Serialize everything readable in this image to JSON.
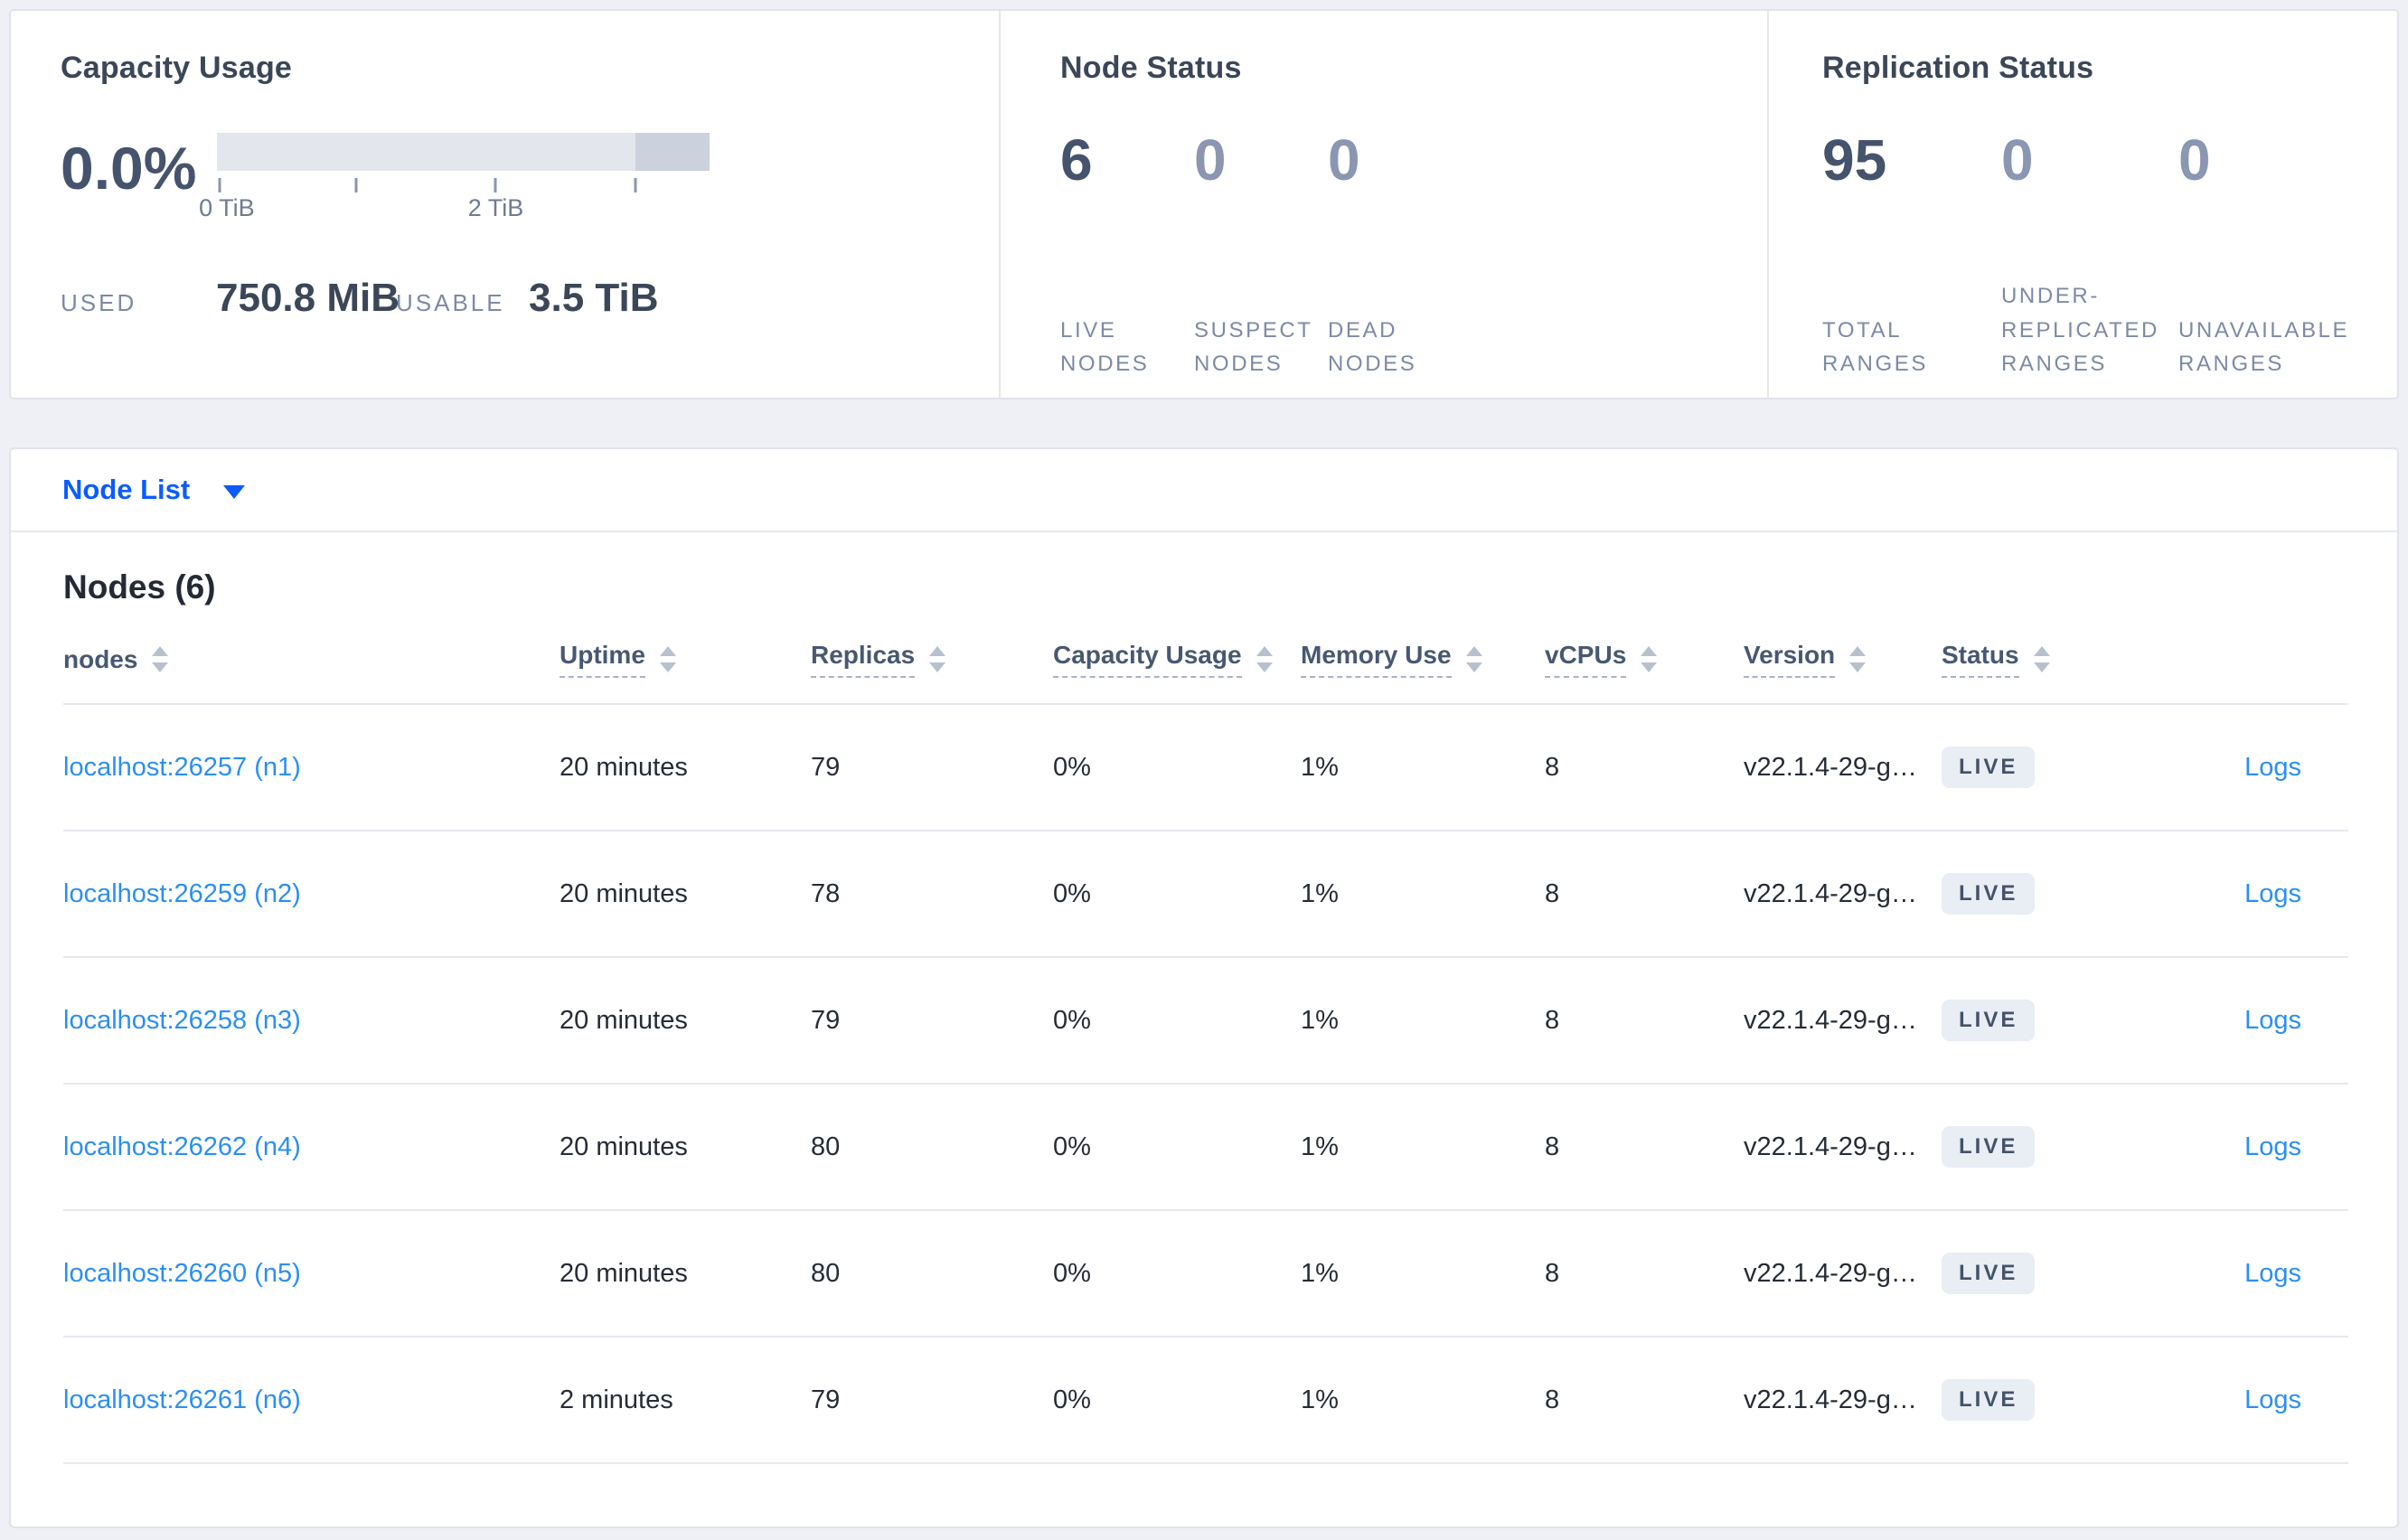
{
  "summary": {
    "capacity": {
      "title": "Capacity Usage",
      "percent": "0.0%",
      "tick_label_0": "0 TiB",
      "tick_label_2": "2 TiB",
      "used_label": "USED",
      "used_value": "750.8 MiB",
      "usable_label": "USABLE",
      "usable_value": "3.5 TiB"
    },
    "node_status": {
      "title": "Node Status",
      "stats": [
        {
          "value": "6",
          "label": "LIVE\nNODES"
        },
        {
          "value": "0",
          "label": "SUSPECT\nNODES"
        },
        {
          "value": "0",
          "label": "DEAD\nNODES"
        }
      ]
    },
    "replication": {
      "title": "Replication Status",
      "stats": [
        {
          "value": "95",
          "label": "TOTAL\nRANGES"
        },
        {
          "value": "0",
          "label": "UNDER-\nREPLICATED\nRANGES"
        },
        {
          "value": "0",
          "label": "UNAVAILABLE\nRANGES"
        }
      ]
    }
  },
  "node_list": {
    "label": "Node List"
  },
  "nodes_section": {
    "heading": "Nodes (6)",
    "columns": [
      "nodes",
      "Uptime",
      "Replicas",
      "Capacity Usage",
      "Memory Use",
      "vCPUs",
      "Version",
      "Status"
    ],
    "rows": [
      {
        "node": "localhost:26257 (n1)",
        "uptime": "20 minutes",
        "replicas": "79",
        "capacity": "0%",
        "memory": "1%",
        "vcpus": "8",
        "version": "v22.1.4-29-g…",
        "status": "LIVE",
        "logs": "Logs"
      },
      {
        "node": "localhost:26259 (n2)",
        "uptime": "20 minutes",
        "replicas": "78",
        "capacity": "0%",
        "memory": "1%",
        "vcpus": "8",
        "version": "v22.1.4-29-g…",
        "status": "LIVE",
        "logs": "Logs"
      },
      {
        "node": "localhost:26258 (n3)",
        "uptime": "20 minutes",
        "replicas": "79",
        "capacity": "0%",
        "memory": "1%",
        "vcpus": "8",
        "version": "v22.1.4-29-g…",
        "status": "LIVE",
        "logs": "Logs"
      },
      {
        "node": "localhost:26262 (n4)",
        "uptime": "20 minutes",
        "replicas": "80",
        "capacity": "0%",
        "memory": "1%",
        "vcpus": "8",
        "version": "v22.1.4-29-g…",
        "status": "LIVE",
        "logs": "Logs"
      },
      {
        "node": "localhost:26260 (n5)",
        "uptime": "20 minutes",
        "replicas": "80",
        "capacity": "0%",
        "memory": "1%",
        "vcpus": "8",
        "version": "v22.1.4-29-g…",
        "status": "LIVE",
        "logs": "Logs"
      },
      {
        "node": "localhost:26261 (n6)",
        "uptime": "2 minutes",
        "replicas": "79",
        "capacity": "0%",
        "memory": "1%",
        "vcpus": "8",
        "version": "v22.1.4-29-g…",
        "status": "LIVE",
        "logs": "Logs"
      }
    ]
  },
  "colors": {
    "page_background": "#eef0f5",
    "card_border": "#e0e3ea",
    "primary_link_blue": "#0b5bff",
    "secondary_link_blue": "#2b8ff2",
    "dark_slate": "#46536d",
    "muted_stat": "#8a96b2",
    "bar_light": "#e4e6ee",
    "bar_dark": "#ccd1de",
    "badge_background": "#e9edf4"
  }
}
